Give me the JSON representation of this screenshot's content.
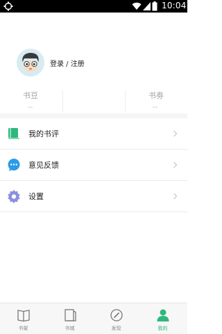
{
  "status_bar": {
    "time": "10:04"
  },
  "profile": {
    "login_label": "登录 / 注册"
  },
  "stats": [
    {
      "label": "书豆",
      "value": "--"
    },
    {
      "label": "书劵",
      "value": "--"
    }
  ],
  "menu": [
    {
      "label": "我的书评",
      "icon": "book-review-icon"
    },
    {
      "label": "意见反馈",
      "icon": "feedback-icon"
    },
    {
      "label": "设置",
      "icon": "settings-icon"
    }
  ],
  "tabs": [
    {
      "label": "书架",
      "icon": "bookshelf-icon",
      "active": false
    },
    {
      "label": "书城",
      "icon": "bookstore-icon",
      "active": false
    },
    {
      "label": "发现",
      "icon": "discover-icon",
      "active": false
    },
    {
      "label": "我的",
      "icon": "profile-icon",
      "active": true
    }
  ],
  "colors": {
    "accent": "#2eb87e",
    "feedback": "#2d9be6",
    "settings": "#8a8fe0"
  }
}
